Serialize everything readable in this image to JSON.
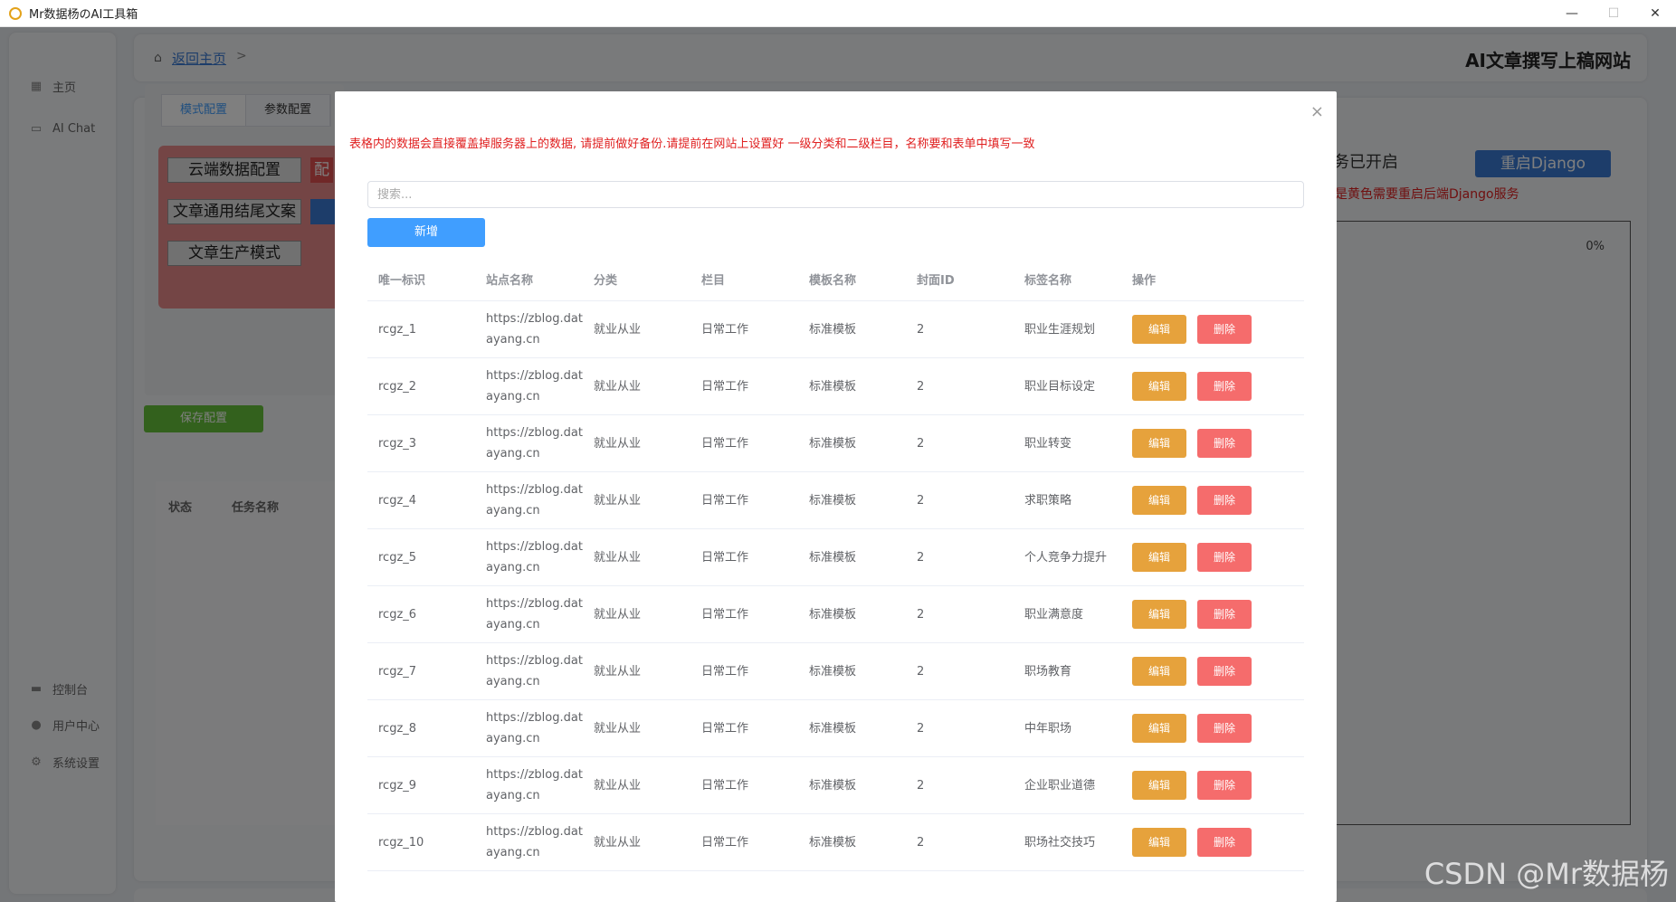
{
  "window": {
    "title": "Mr数据杨のAI工具箱",
    "minimize": "—",
    "maximize": "☐",
    "close": "✕"
  },
  "sidebar": {
    "items": [
      {
        "label": "主页",
        "icon": "grid-icon"
      },
      {
        "label": "AI Chat",
        "icon": "chat-icon"
      },
      {
        "label": "控制台",
        "icon": "monitor-icon"
      },
      {
        "label": "用户中心",
        "icon": "user-icon"
      },
      {
        "label": "系统设置",
        "icon": "gear-icon"
      }
    ]
  },
  "topbar": {
    "back_link": "返回主页",
    "separator": ">",
    "site_title": "AI文章撰写上稿网站"
  },
  "config": {
    "tabs": [
      "模式配置",
      "参数配置"
    ],
    "buttons": [
      "云端数据配置",
      "文章通用结尾文案",
      "文章生产模式"
    ],
    "tag": "配",
    "save_label": "保存配置"
  },
  "task_table": {
    "headers": [
      "状态",
      "任务名称"
    ]
  },
  "server": {
    "status_text": "务已开启",
    "restart_label": "重启Django",
    "warning": "是黄色需要重启后端Django服务",
    "progress": "0%"
  },
  "modal": {
    "close": "×",
    "notice": "表格内的数据会直接覆盖掉服务器上的数据, 请提前做好备份.请提前在网站上设置好 一级分类和二级栏目，名称要和表单中填写一致",
    "search_placeholder": "搜索...",
    "add_label": "新增",
    "headers": [
      "唯一标识",
      "站点名称",
      "分类",
      "栏目",
      "模板名称",
      "封面ID",
      "标签名称",
      "操作"
    ],
    "edit_label": "编辑",
    "delete_label": "删除",
    "rows": [
      {
        "id": "rcgz_1",
        "site": "https://zblog.datayang.cn",
        "category": "就业从业",
        "column": "日常工作",
        "template": "标准模板",
        "cover_id": "2",
        "tag": "职业生涯规划"
      },
      {
        "id": "rcgz_2",
        "site": "https://zblog.datayang.cn",
        "category": "就业从业",
        "column": "日常工作",
        "template": "标准模板",
        "cover_id": "2",
        "tag": "职业目标设定"
      },
      {
        "id": "rcgz_3",
        "site": "https://zblog.datayang.cn",
        "category": "就业从业",
        "column": "日常工作",
        "template": "标准模板",
        "cover_id": "2",
        "tag": "职业转变"
      },
      {
        "id": "rcgz_4",
        "site": "https://zblog.datayang.cn",
        "category": "就业从业",
        "column": "日常工作",
        "template": "标准模板",
        "cover_id": "2",
        "tag": "求职策略"
      },
      {
        "id": "rcgz_5",
        "site": "https://zblog.datayang.cn",
        "category": "就业从业",
        "column": "日常工作",
        "template": "标准模板",
        "cover_id": "2",
        "tag": "个人竞争力提升"
      },
      {
        "id": "rcgz_6",
        "site": "https://zblog.datayang.cn",
        "category": "就业从业",
        "column": "日常工作",
        "template": "标准模板",
        "cover_id": "2",
        "tag": "职业满意度"
      },
      {
        "id": "rcgz_7",
        "site": "https://zblog.datayang.cn",
        "category": "就业从业",
        "column": "日常工作",
        "template": "标准模板",
        "cover_id": "2",
        "tag": "职场教育"
      },
      {
        "id": "rcgz_8",
        "site": "https://zblog.datayang.cn",
        "category": "就业从业",
        "column": "日常工作",
        "template": "标准模板",
        "cover_id": "2",
        "tag": "中年职场"
      },
      {
        "id": "rcgz_9",
        "site": "https://zblog.datayang.cn",
        "category": "就业从业",
        "column": "日常工作",
        "template": "标准模板",
        "cover_id": "2",
        "tag": "企业职业道德"
      },
      {
        "id": "rcgz_10",
        "site": "https://zblog.datayang.cn",
        "category": "就业从业",
        "column": "日常工作",
        "template": "标准模板",
        "cover_id": "2",
        "tag": "职场社交技巧"
      }
    ]
  },
  "watermark": "CSDN @Mr数据杨",
  "colors": {
    "primary": "#409eff",
    "edit": "#e6a23c",
    "delete": "#f56c6c",
    "save": "#67c23a",
    "notice": "#e02020",
    "restart": "#3a7bd5"
  }
}
